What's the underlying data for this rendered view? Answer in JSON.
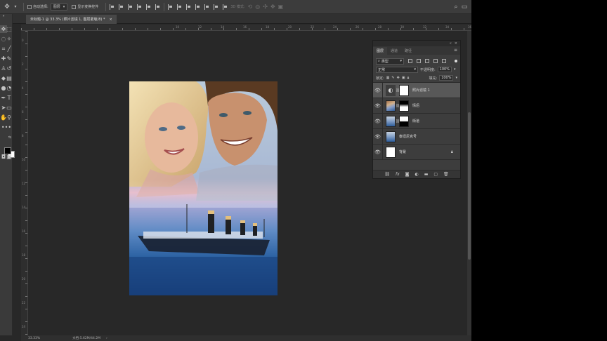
{
  "options_bar": {
    "auto_select_label": "自动选择:",
    "auto_select_value": "图层",
    "transform_controls_label": "显示变换控件",
    "mode_3d_label": "3D 模式:",
    "move_icon": "move-icon",
    "search_icon": "search-icon",
    "workspace_icon": "workspace-icon"
  },
  "document_tab": {
    "title": "未标题-1 @ 33.3% (照片滤镜 1, 图层蒙版/8) *",
    "close": "×"
  },
  "rulers": {
    "top_labels": [
      "10",
      "12",
      "14",
      "16",
      "18",
      "20",
      "22",
      "24",
      "26",
      "28",
      "30",
      "32",
      "34",
      "36"
    ],
    "left_labels": [
      "0",
      "2",
      "4",
      "6",
      "8",
      "10",
      "12",
      "14",
      "16",
      "18",
      "20",
      "22",
      "24"
    ]
  },
  "layers_panel": {
    "tabs": [
      "图层",
      "通道",
      "路径"
    ],
    "active_tab": "图层",
    "filter_label": "类型",
    "blend_mode": "正常",
    "opacity_label": "不透明度:",
    "opacity_value": "100%",
    "lock_label": "锁定:",
    "fill_label": "填充:",
    "fill_value": "100%",
    "collapse_icon": "«",
    "close_icon": "×",
    "layers": [
      {
        "name": "照片滤镜 1",
        "selected": true
      },
      {
        "name": "情侣"
      },
      {
        "name": "街道"
      },
      {
        "name": "泰坦尼克号"
      },
      {
        "name": "背景"
      }
    ]
  },
  "status_bar": {
    "zoom": "33.33%",
    "doc_info": "文档:5.62M/44.2M"
  },
  "colors": {
    "app_background": "#282828",
    "panel": "#3d3d3d",
    "selected_layer": "#585858"
  }
}
